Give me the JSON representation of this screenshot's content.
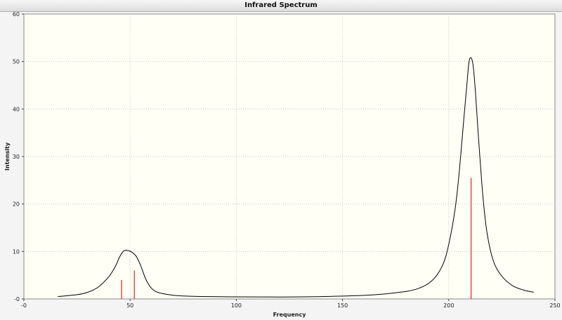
{
  "chart_data": {
    "type": "line",
    "title": "Infrared Spectrum",
    "xlabel": "Frequency",
    "ylabel": "Intensity",
    "xlim": [
      0,
      250
    ],
    "ylim": [
      0,
      60
    ],
    "x_ticks": [
      0,
      50,
      100,
      150,
      200,
      250
    ],
    "x_tick_labels": [
      "-0",
      "50",
      "100",
      "150",
      "200",
      "250"
    ],
    "y_ticks": [
      0,
      10,
      20,
      30,
      40,
      50,
      60
    ],
    "y_tick_labels": [
      "-0",
      "10",
      "20",
      "30",
      "40",
      "50",
      "60"
    ],
    "grid": true,
    "series": [
      {
        "kind": "line",
        "color": "#000000",
        "x": [
          16,
          25,
          30,
          35,
          40,
          43,
          45,
          47,
          49,
          51,
          53,
          55,
          58,
          62,
          70,
          80,
          100,
          120,
          140,
          160,
          175,
          185,
          192,
          197,
          200,
          203,
          205,
          207,
          208.5,
          209.5,
          210.5,
          211.5,
          212.5,
          214,
          216,
          218,
          221,
          225,
          230,
          235,
          240
        ],
        "y": [
          0.5,
          0.9,
          1.4,
          2.5,
          4.7,
          6.8,
          8.8,
          10.1,
          10.2,
          9.8,
          8.9,
          7.0,
          3.6,
          1.6,
          0.8,
          0.55,
          0.45,
          0.42,
          0.5,
          0.75,
          1.3,
          2.1,
          3.8,
          7.0,
          11.5,
          19,
          27,
          37.5,
          45,
          49.8,
          50.8,
          49,
          44,
          34,
          22,
          14,
          8,
          4.8,
          2.8,
          1.9,
          1.4
        ]
      }
    ],
    "sticks": {
      "kind": "stick",
      "color": "#e8201c",
      "x": [
        46,
        52,
        210.5
      ],
      "y": [
        4,
        6,
        25.5
      ]
    }
  }
}
